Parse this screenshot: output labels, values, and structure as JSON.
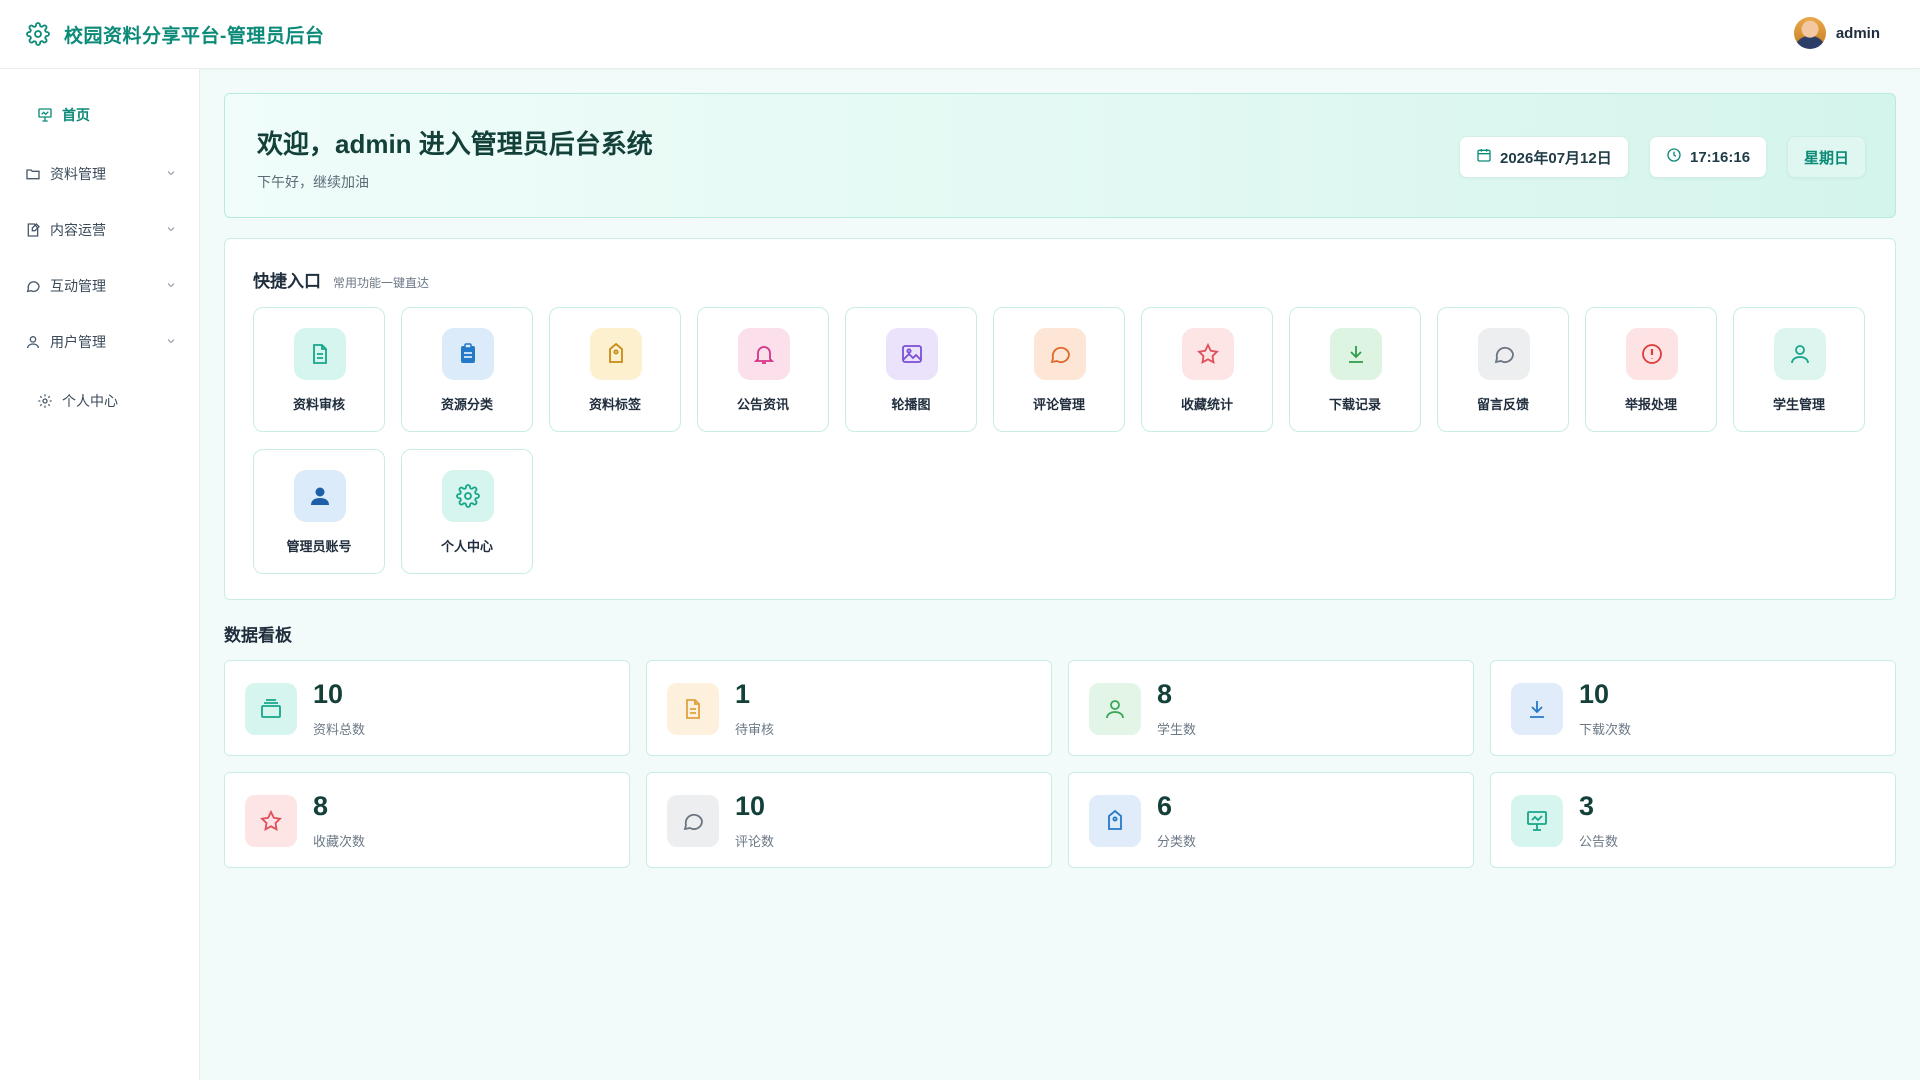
{
  "app": {
    "title": "校园资料分享平台-管理员后台"
  },
  "user": {
    "name": "admin"
  },
  "sidebar": {
    "items": [
      {
        "label": "首页",
        "icon": "presentation-chart-icon",
        "active": true,
        "expandable": false
      },
      {
        "label": "资料管理",
        "icon": "folder-icon",
        "active": false,
        "expandable": true
      },
      {
        "label": "内容运营",
        "icon": "document-edit-icon",
        "active": false,
        "expandable": true
      },
      {
        "label": "互动管理",
        "icon": "chat-bubble-icon",
        "active": false,
        "expandable": true
      },
      {
        "label": "用户管理",
        "icon": "user-icon",
        "active": false,
        "expandable": true
      },
      {
        "label": "个人中心",
        "icon": "gear-icon",
        "active": false,
        "expandable": false
      }
    ]
  },
  "welcome": {
    "title": "欢迎，admin 进入管理员后台系统",
    "subtitle": "下午好，继续加油",
    "date": "2026年07月12日",
    "time": "17:16:16",
    "weekday": "星期日"
  },
  "quick": {
    "title": "快捷入口",
    "subtitle": "常用功能一键直达",
    "items": [
      {
        "label": "资料审核",
        "icon": "document-icon",
        "color": "#17a589",
        "bg": "#d6f5ee"
      },
      {
        "label": "资源分类",
        "icon": "clipboard-icon",
        "color": "#2479c9",
        "bg": "#dcebfa"
      },
      {
        "label": "资料标签",
        "icon": "tag-icon",
        "color": "#c98a16",
        "bg": "#fdf0cf"
      },
      {
        "label": "公告资讯",
        "icon": "bell-icon",
        "color": "#d63384",
        "bg": "#fbe0ec"
      },
      {
        "label": "轮播图",
        "icon": "image-icon",
        "color": "#7b4fd6",
        "bg": "#ebe2fb"
      },
      {
        "label": "评论管理",
        "icon": "comment-icon",
        "color": "#e0692a",
        "bg": "#fde6d6"
      },
      {
        "label": "收藏统计",
        "icon": "star-icon",
        "color": "#e0505a",
        "bg": "#fde5e6"
      },
      {
        "label": "下载记录",
        "icon": "download-icon",
        "color": "#2e9c4a",
        "bg": "#ddf4e2"
      },
      {
        "label": "留言反馈",
        "icon": "message-icon",
        "color": "#6b7580",
        "bg": "#eceef0"
      },
      {
        "label": "举报处理",
        "icon": "alert-icon",
        "color": "#e03b3b",
        "bg": "#fde3e3"
      },
      {
        "label": "学生管理",
        "icon": "user-icon",
        "color": "#17a589",
        "bg": "#ddf5ee"
      },
      {
        "label": "管理员账号",
        "icon": "admin-user-icon",
        "color": "#1f5fa8",
        "bg": "#dcebfa"
      },
      {
        "label": "个人中心",
        "icon": "gear-icon",
        "color": "#17a589",
        "bg": "#d6f5ee"
      }
    ]
  },
  "board": {
    "title": "数据看板",
    "stats": [
      {
        "value": "10",
        "label": "资料总数",
        "icon": "stack-icon",
        "color": "#17a589",
        "bg": "#d6f5ee"
      },
      {
        "value": "1",
        "label": "待审核",
        "icon": "document-icon",
        "color": "#e0a040",
        "bg": "#fdf1de"
      },
      {
        "value": "8",
        "label": "学生数",
        "icon": "user-icon",
        "color": "#3aa657",
        "bg": "#e3f5e6"
      },
      {
        "value": "10",
        "label": "下载次数",
        "icon": "download-icon",
        "color": "#2479c9",
        "bg": "#e0ecfa"
      },
      {
        "value": "8",
        "label": "收藏次数",
        "icon": "star-icon",
        "color": "#e0505a",
        "bg": "#fde5e6"
      },
      {
        "value": "10",
        "label": "评论数",
        "icon": "message-icon",
        "color": "#6b7580",
        "bg": "#eceef0"
      },
      {
        "value": "6",
        "label": "分类数",
        "icon": "tag-icon",
        "color": "#2479c9",
        "bg": "#e0ecfa"
      },
      {
        "value": "3",
        "label": "公告数",
        "icon": "presentation-chart-icon",
        "color": "#17a589",
        "bg": "#d6f5ee"
      }
    ]
  }
}
